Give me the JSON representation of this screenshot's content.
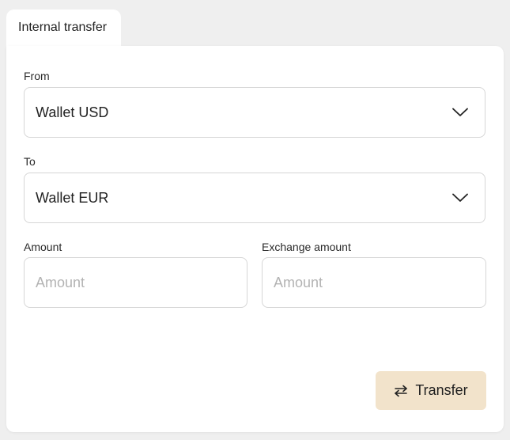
{
  "tab": {
    "label": "Internal transfer"
  },
  "form": {
    "from": {
      "label": "From",
      "value": "Wallet USD"
    },
    "to": {
      "label": "To",
      "value": "Wallet EUR"
    },
    "amount": {
      "label": "Amount",
      "placeholder": "Amount"
    },
    "exchange_amount": {
      "label": "Exchange amount",
      "placeholder": "Amount"
    }
  },
  "actions": {
    "transfer_label": "Transfer"
  },
  "colors": {
    "page_bg": "#efefef",
    "card_bg": "#ffffff",
    "border": "#d6d6d6",
    "button_bg": "#f2e3cb",
    "placeholder": "#b3b3b3"
  },
  "icons": {
    "dropdown": "chevron-down-icon",
    "transfer": "swap-arrows-icon"
  }
}
